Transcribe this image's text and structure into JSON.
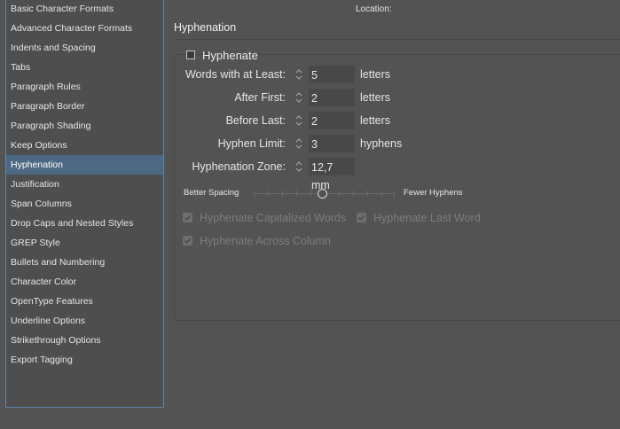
{
  "sidebar": {
    "items": [
      {
        "label": "Basic Character Formats"
      },
      {
        "label": "Advanced Character Formats"
      },
      {
        "label": "Indents and Spacing"
      },
      {
        "label": "Tabs"
      },
      {
        "label": "Paragraph Rules"
      },
      {
        "label": "Paragraph Border"
      },
      {
        "label": "Paragraph Shading"
      },
      {
        "label": "Keep Options"
      },
      {
        "label": "Hyphenation",
        "selected": true
      },
      {
        "label": "Justification"
      },
      {
        "label": "Span Columns"
      },
      {
        "label": "Drop Caps and Nested Styles"
      },
      {
        "label": "GREP Style"
      },
      {
        "label": "Bullets and Numbering"
      },
      {
        "label": "Character Color"
      },
      {
        "label": "OpenType Features"
      },
      {
        "label": "Underline Options"
      },
      {
        "label": "Strikethrough Options"
      },
      {
        "label": "Export Tagging"
      }
    ]
  },
  "header": {
    "location_label": "Location:"
  },
  "section": {
    "title": "Hyphenation"
  },
  "hyphenate": {
    "label": "Hyphenate",
    "checked": false
  },
  "fields": {
    "words_at_least": {
      "label": "Words with at Least:",
      "value": "5",
      "unit": "letters"
    },
    "after_first": {
      "label": "After First:",
      "value": "2",
      "unit": "letters"
    },
    "before_last": {
      "label": "Before Last:",
      "value": "2",
      "unit": "letters"
    },
    "hyphen_limit": {
      "label": "Hyphen Limit:",
      "value": "3",
      "unit": "hyphens"
    },
    "hyphenation_zone": {
      "label": "Hyphenation Zone:",
      "value": "12,7 mm"
    }
  },
  "slider": {
    "left_label": "Better Spacing",
    "right_label": "Fewer Hyphens",
    "position": 0.5
  },
  "options": {
    "capitalized": {
      "label": "Hyphenate Capitalized Words",
      "checked": true,
      "enabled": false
    },
    "last_word": {
      "label": "Hyphenate Last Word",
      "checked": true,
      "enabled": false
    },
    "across_column": {
      "label": "Hyphenate Across Column",
      "checked": true,
      "enabled": false
    }
  },
  "colors": {
    "selection": "#4d6882",
    "sidebar_border": "#5f86ab",
    "background": "#535353"
  }
}
